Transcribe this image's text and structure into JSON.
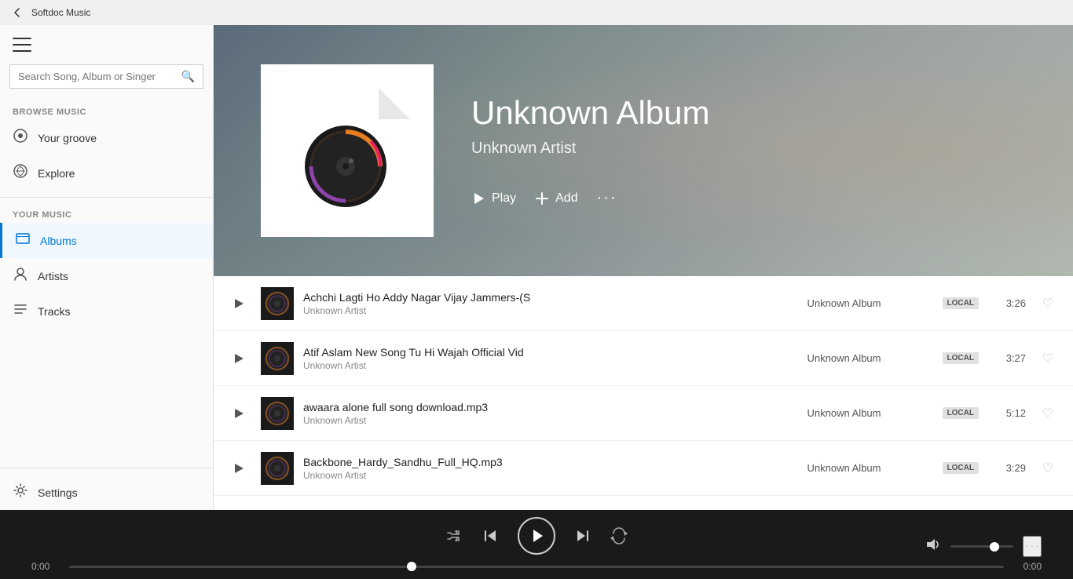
{
  "titleBar": {
    "appName": "Softdoc Music"
  },
  "sidebar": {
    "searchPlaceholder": "Search Song, Album or Singer",
    "browseMusicLabel": "BROWSE MUSIC",
    "yourMusicLabel": "YOUR MUSIC",
    "items": [
      {
        "id": "your-groove",
        "label": "Your groove",
        "icon": "♪"
      },
      {
        "id": "explore",
        "label": "Explore",
        "icon": "◉"
      }
    ],
    "yourMusicItems": [
      {
        "id": "albums",
        "label": "Albums",
        "icon": "⊟",
        "active": true
      },
      {
        "id": "artists",
        "label": "Artists",
        "icon": "👤"
      },
      {
        "id": "tracks",
        "label": "Tracks",
        "icon": "≡"
      }
    ],
    "settingsLabel": "Settings"
  },
  "hero": {
    "albumTitle": "Unknown Album",
    "artistName": "Unknown Artist",
    "playLabel": "Play",
    "addLabel": "Add",
    "moreLabel": "···"
  },
  "tracks": [
    {
      "name": "Achchi Lagti Ho Addy Nagar Vijay Jammers-(S",
      "artist": "Unknown Artist",
      "album": "Unknown Album",
      "badge": "LOCAL",
      "duration": "3:26"
    },
    {
      "name": "Atif Aslam New Song Tu Hi Wajah Official Vid",
      "artist": "Unknown Artist",
      "album": "Unknown Album",
      "badge": "LOCAL",
      "duration": "3:27"
    },
    {
      "name": "awaara alone full song download.mp3",
      "artist": "Unknown Artist",
      "album": "Unknown Album",
      "badge": "LOCAL",
      "duration": "5:12"
    },
    {
      "name": "Backbone_Hardy_Sandhu_Full_HQ.mp3",
      "artist": "Unknown Artist",
      "album": "Unknown Album",
      "badge": "LOCAL",
      "duration": "3:29"
    }
  ],
  "player": {
    "currentTime": "0:00",
    "totalTime": "0:00"
  }
}
